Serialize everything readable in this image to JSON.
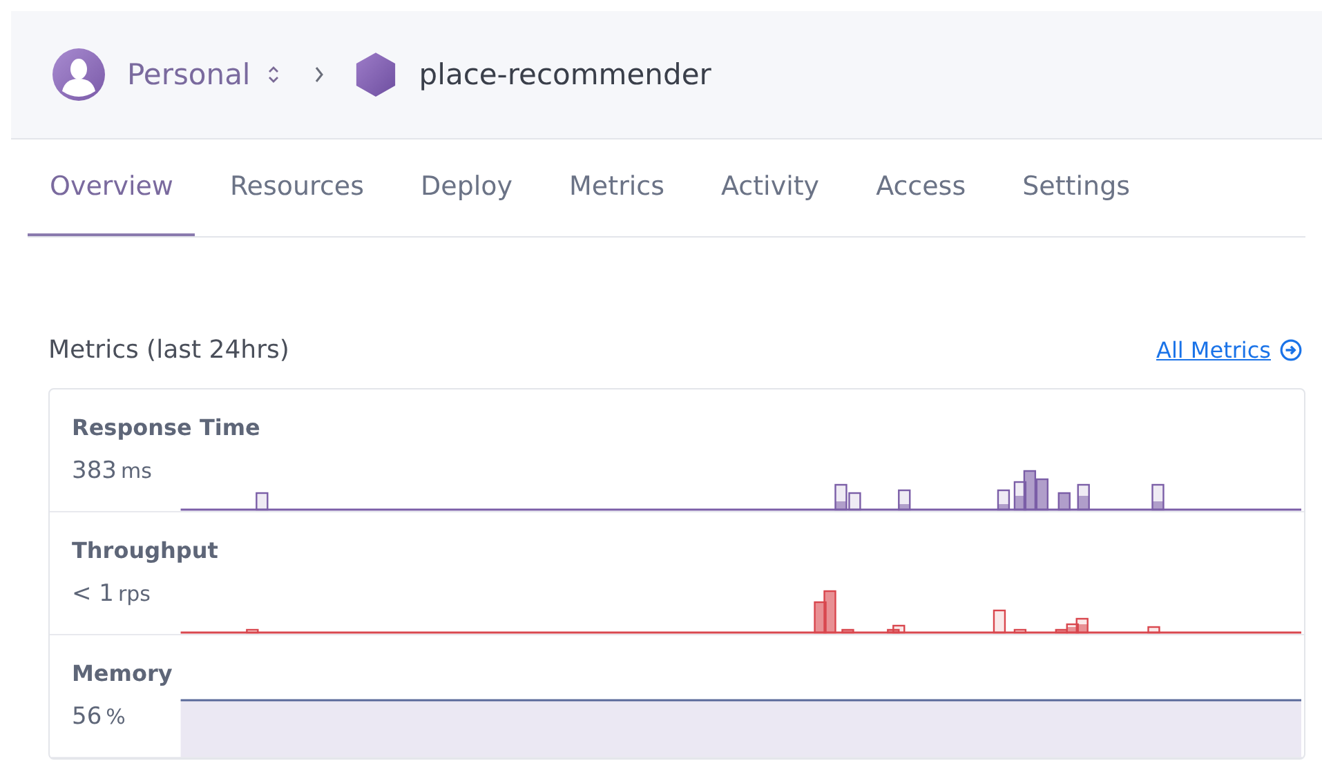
{
  "breadcrumb": {
    "account": "Personal",
    "app": "place-recommender"
  },
  "tabs": [
    {
      "label": "Overview",
      "selected": true
    },
    {
      "label": "Resources",
      "selected": false
    },
    {
      "label": "Deploy",
      "selected": false
    },
    {
      "label": "Metrics",
      "selected": false
    },
    {
      "label": "Activity",
      "selected": false
    },
    {
      "label": "Access",
      "selected": false
    },
    {
      "label": "Settings",
      "selected": false
    }
  ],
  "metrics_section": {
    "title": "Metrics (last 24hrs)",
    "link": "All Metrics",
    "metrics": [
      {
        "kind": "spikes",
        "name": "Response Time",
        "value": "383",
        "unit": "ms",
        "color": "#7b5ea7"
      },
      {
        "kind": "spikes",
        "name": "Throughput",
        "value": "< 1",
        "unit": "rps",
        "color": "#d9474e"
      },
      {
        "kind": "area",
        "name": "Memory",
        "value": "56",
        "unit": "%",
        "color": "#5a6a9a"
      }
    ]
  }
}
